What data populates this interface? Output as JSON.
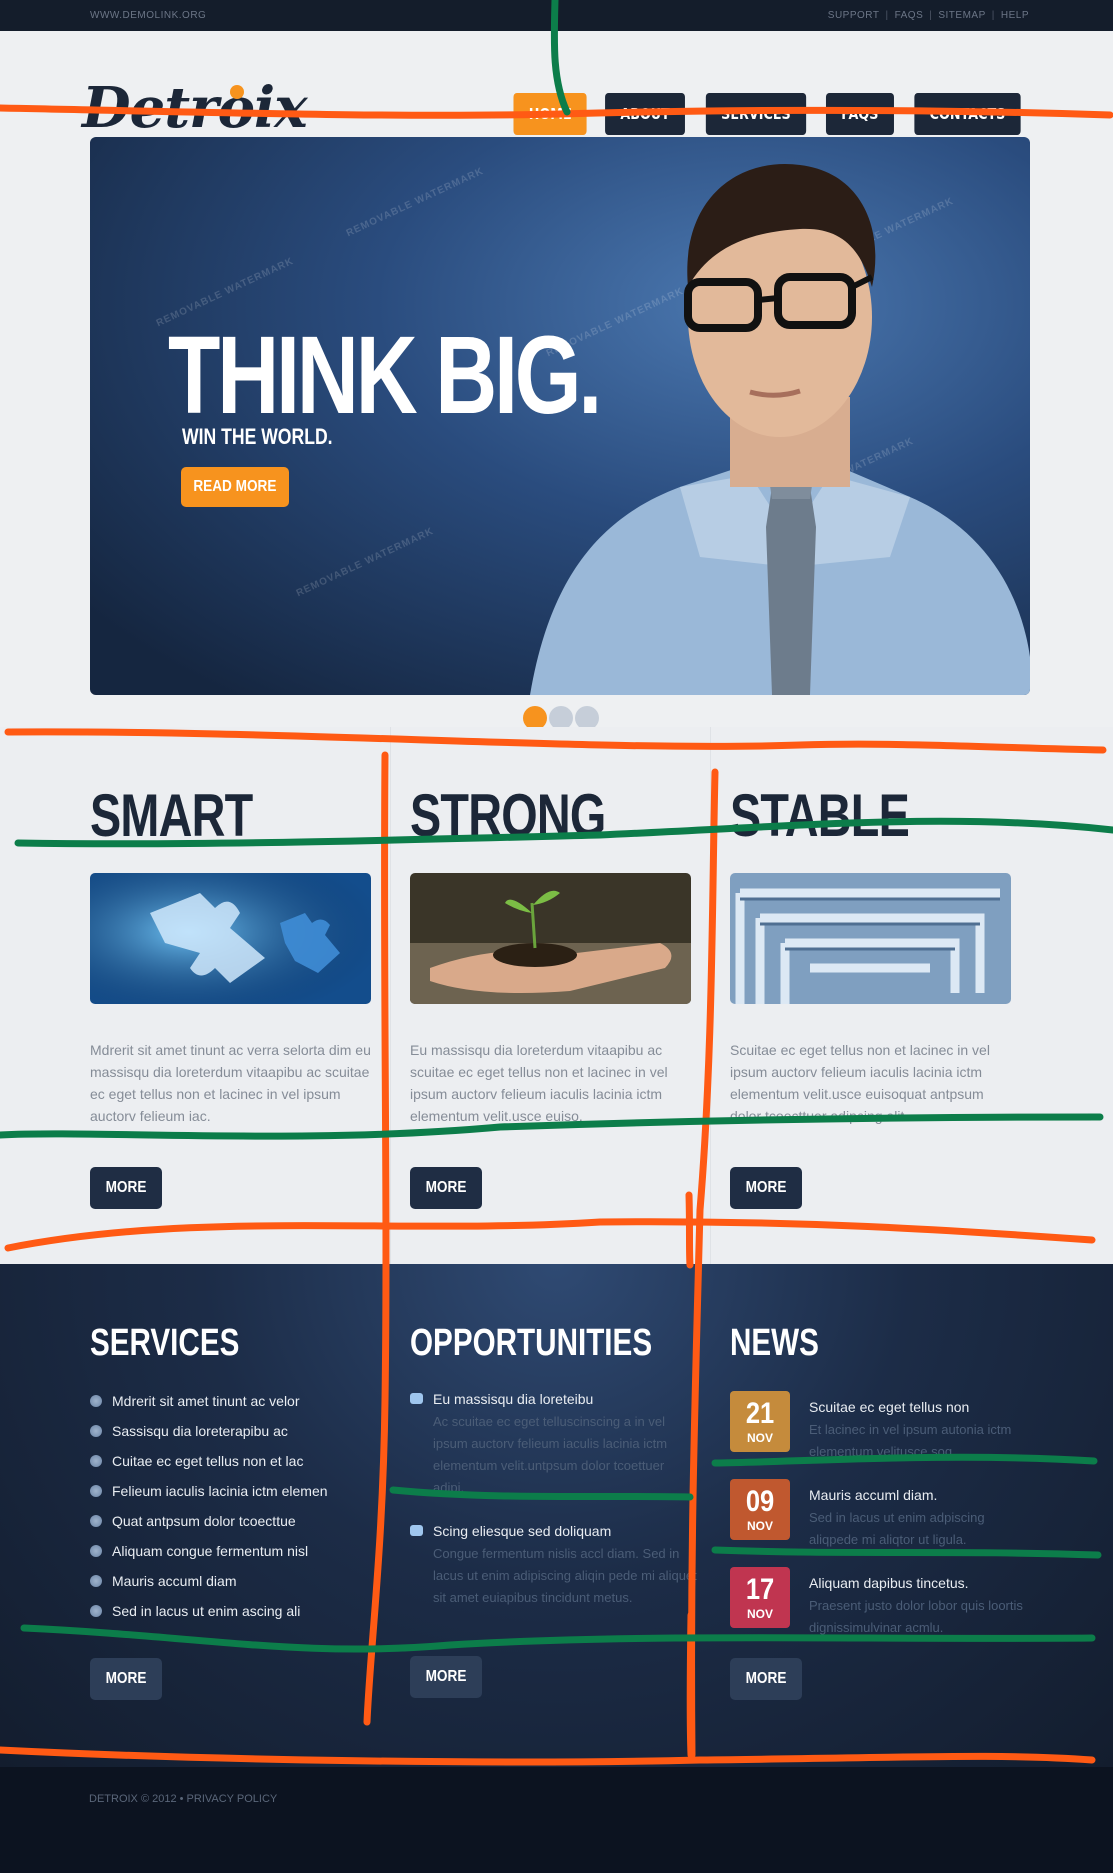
{
  "topbar": {
    "site_url": "WWW.DEMOLINK.ORG",
    "links": [
      "SUPPORT",
      "FAQS",
      "SITEMAP",
      "HELP"
    ]
  },
  "logo": {
    "text": "Detroix"
  },
  "nav": {
    "items": [
      "Home",
      "About",
      "Services",
      "FAQs",
      "Contacts"
    ],
    "active": "Home"
  },
  "hero": {
    "title": "THINK BIG.",
    "subtitle": "WIN THE WORLD.",
    "button": "Read More",
    "watermark": "REMOVABLE WATERMARK",
    "slides_total": 3,
    "active_slide": 1
  },
  "features": [
    {
      "title": "SMART",
      "image": "puzzle pieces",
      "text": "Mdrerit sit amet tinunt ac verra selorta dim eu massisqu dia loreterdum vitaapibu ac scuitae ec eget tellus non et lacinec in vel ipsum auctorv felieum iac.",
      "button": "MORE"
    },
    {
      "title": "STRONG",
      "image": "sprout in hand",
      "text": "Eu massisqu dia loreterdum vitaapibu ac scuitae ec eget tellus non et lacinec in vel ipsum auctorv felieum iaculis lacinia ictm elementum velit.usce euiso.",
      "button": "MORE"
    },
    {
      "title": "STABLE",
      "image": "maze",
      "text": "Scuitae ec eget tellus non et lacinec in vel ipsum auctorv felieum iaculis lacinia ictm elementum velit.usce euisoquat antpsum dolor tcoecttuer adipcing elit.",
      "button": "MORE"
    }
  ],
  "services": {
    "title": "SERVICES",
    "items": [
      "Mdrerit sit amet tinunt ac velor",
      "Sassisqu dia loreterapibu ac",
      "Cuitae ec eget tellus non et lac",
      "Felieum iaculis lacinia ictm elemen",
      "Quat antpsum dolor tcoecttue",
      "Aliquam congue fermentum nisl",
      "Mauris accuml diam",
      "Sed in lacus ut enim ascing ali"
    ],
    "button": "MORE"
  },
  "opportunities": {
    "title": "OPPORTUNITIES",
    "items": [
      {
        "title": "Eu massisqu dia loreteibu",
        "text": "Ac scuitae ec eget telluscinscing a in vel ipsum auctorv felieum iaculis lacinia ictm elementum velit.untpsum dolor tcoettuer adipi."
      },
      {
        "title": "Scing eliesque sed doliquam",
        "text": "Congue fermentum nislis accl diam. Sed in lacus ut enim adipiscing aliqin pede mi aliquet sit amet euiapibus tincidunt metus."
      }
    ],
    "button": "MORE"
  },
  "news": {
    "title": "NEWS",
    "items": [
      {
        "day": "21",
        "month": "NOV",
        "title": "Scuitae ec eget tellus non",
        "text": "Et lacinec in vel ipsum autonia ictm elementum velitusce soq.",
        "color": "#c58b3c"
      },
      {
        "day": "09",
        "month": "NOV",
        "title": "Mauris accuml diam.",
        "text": "Sed in lacus ut enim adpiscing aliqpede mi aliqtor ut ligula.",
        "color": "#c0582f"
      },
      {
        "day": "17",
        "month": "NOV",
        "title": "Aliquam dapibus tincetus.",
        "text": "Praesent justo dolor lobor quis loortis dignissimulvinar acmlu.",
        "color": "#c03550"
      }
    ],
    "button": "MORE"
  },
  "footer": {
    "copyright": "DETROIX © 2012 • PRIVACY POLICY"
  },
  "colors": {
    "accent": "#f7931e",
    "navy": "#1c2738",
    "annotation_orange": "#ff5a14",
    "annotation_green": "#0c7d4a"
  }
}
